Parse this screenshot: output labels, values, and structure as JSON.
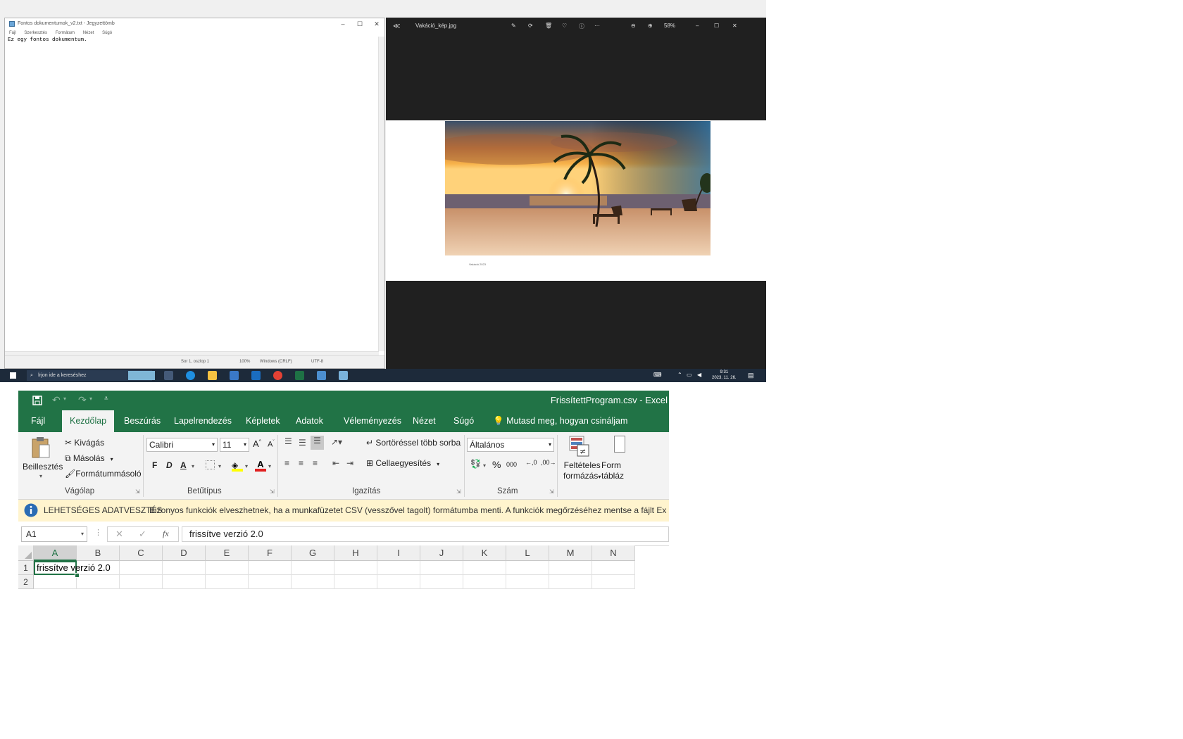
{
  "notepad": {
    "title": "Fontos dokumentumok_v2.txt - Jegyzettömb",
    "menu": [
      "Fájl",
      "Szerkesztés",
      "Formátum",
      "Nézet",
      "Súgó"
    ],
    "content": "Ez egy fontos dokumentum.",
    "status": {
      "position": "Sor 1, oszlop 1",
      "zoom": "100%",
      "line_ending": "Windows (CRLF)",
      "encoding": "UTF-8"
    }
  },
  "photos": {
    "title": "Vakáció_kép.jpg",
    "zoom": "58%",
    "caption": "Vakáció 2023"
  },
  "taskbar": {
    "search_placeholder": "Írjon ide a kereséshez",
    "time": "9:31",
    "date": "2023. 11. 26."
  },
  "excel": {
    "title": "FrissítettProgram.csv  -  Excel",
    "tabs": [
      "Fájl",
      "Kezdőlap",
      "Beszúrás",
      "Lapelrendezés",
      "Képletek",
      "Adatok",
      "Véleményezés",
      "Nézet",
      "Súgó"
    ],
    "active_tab": "Kezdőlap",
    "tell_me": "Mutasd meg, hogyan csináljam",
    "ribbon": {
      "paste": "Beillesztés",
      "cut": "Kivágás",
      "copy": "Másolás",
      "format_painter": "Formátummásoló",
      "group_clipboard": "Vágólap",
      "font_name": "Calibri",
      "font_size": "11",
      "bold": "F",
      "italic": "D",
      "underline": "A",
      "group_font": "Betűtípus",
      "wrap": "Sortöréssel több sorba",
      "merge": "Cellaegyesítés",
      "group_align": "Igazítás",
      "number_format": "Általános",
      "percent": "%",
      "thousands": "000",
      "group_number": "Szám",
      "cond_format_1": "Feltételes",
      "cond_format_2": "formázás",
      "format_table_1": "Form",
      "format_table_2": "tábláz"
    },
    "warning": {
      "title": "LEHETSÉGES ADATVESZTÉS",
      "message": "Bizonyos funkciók elveszhetnek, ha a munkafüzetet CSV (vesszővel tagolt) formátumba menti. A funkciók megőrzéséhez mentse a fájlt Ex"
    },
    "name_box": "A1",
    "formula": "frissítve verzió 2.0",
    "fx": "fx",
    "columns": [
      "A",
      "B",
      "C",
      "D",
      "E",
      "F",
      "G",
      "H",
      "I",
      "J",
      "K",
      "L",
      "M",
      "N"
    ],
    "rows": [
      "1",
      "2"
    ],
    "cell_a1": "frissítve verzió 2.0",
    "colors": {
      "brand": "#217346",
      "warning_bg": "#fff4ce"
    }
  }
}
